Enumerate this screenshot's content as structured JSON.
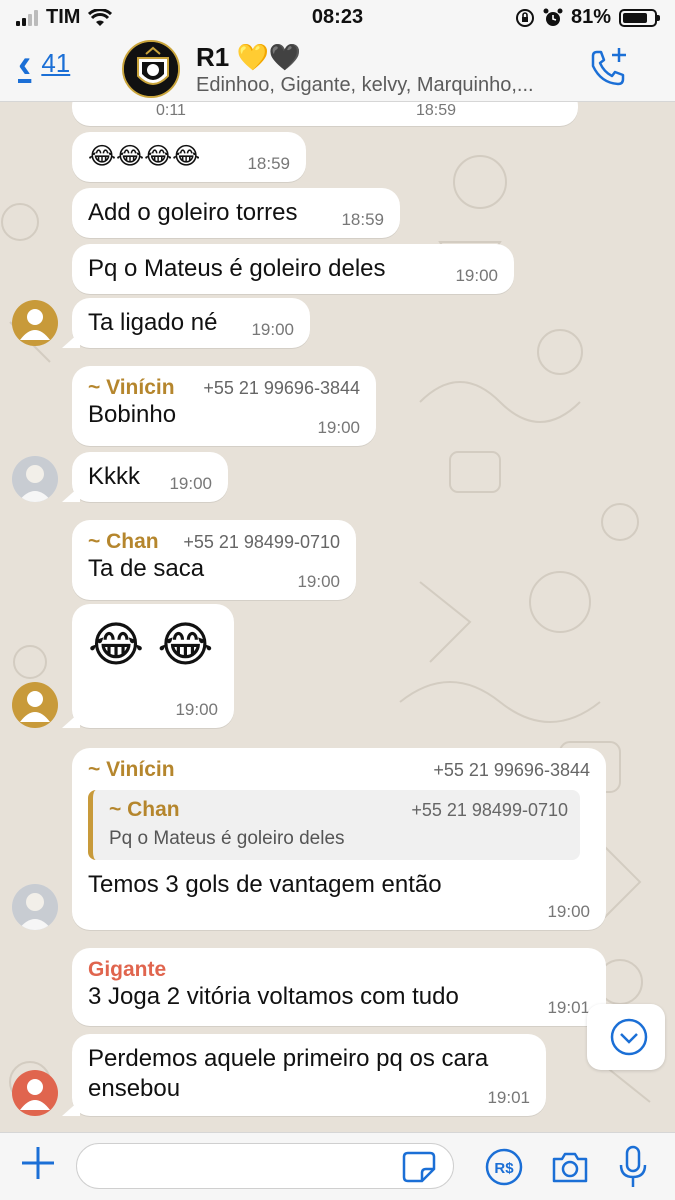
{
  "status": {
    "carrier": "TIM",
    "time": "08:23",
    "battery": "81%",
    "battery_level": 0.81
  },
  "header": {
    "back_count": "41",
    "group_name": "R1 💛🖤",
    "members": "Edinhoo, Gigante, kelvy, Marquinho,..."
  },
  "messages": {
    "top_partial": {
      "left": "0:11",
      "right": "18:59"
    },
    "m1": {
      "text": "😂😂😂😂",
      "time": "18:59"
    },
    "m2": {
      "text": "Add o goleiro torres",
      "time": "18:59"
    },
    "m3": {
      "text": "Pq o Mateus é goleiro deles",
      "time": "19:00"
    },
    "m4": {
      "text": "Ta ligado né",
      "time": "19:00"
    },
    "m5": {
      "sender": "~ Vinícin",
      "phone": "+55 21 99696-3844",
      "text": "Bobinho",
      "time": "19:00"
    },
    "m6": {
      "text": "Kkkk",
      "time": "19:00"
    },
    "m7": {
      "sender": "~ Chan",
      "phone": "+55 21 98499-0710",
      "text": "Ta de saca",
      "time": "19:00"
    },
    "m8": {
      "text": "😂 😂",
      "time": "19:00"
    },
    "m9": {
      "sender": "~ Vinícin",
      "phone": "+55 21 99696-3844",
      "quote": {
        "sender": "~ Chan",
        "phone": "+55 21 98499-0710",
        "text": "Pq o Mateus é goleiro deles"
      },
      "text": "Temos 3 gols de vantagem então",
      "time": "19:00"
    },
    "m10": {
      "sender": "Gigante",
      "text": "3 Joga 2 vitória voltamos com tudo",
      "time": "19:01"
    },
    "m11": {
      "text": "Perdemos aquele primeiro pq os cara ensebou",
      "time": "19:01"
    }
  },
  "colors": {
    "accent": "#1b6fd6",
    "vinicin": "#b5862d",
    "chan": "#b5862d",
    "gigante": "#e0654e"
  },
  "input": {
    "placeholder": ""
  }
}
